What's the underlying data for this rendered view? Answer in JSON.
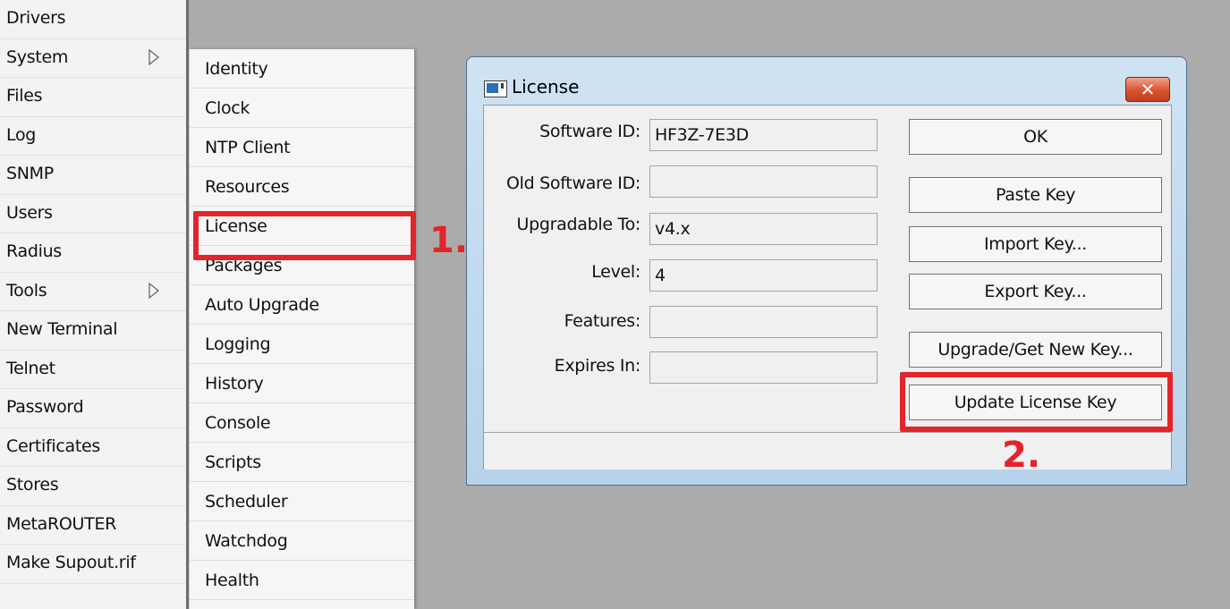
{
  "main_menu": {
    "items": [
      {
        "label": "Drivers",
        "has_submenu": false
      },
      {
        "label": "System",
        "has_submenu": true
      },
      {
        "label": "Files",
        "has_submenu": false
      },
      {
        "label": "Log",
        "has_submenu": false
      },
      {
        "label": "SNMP",
        "has_submenu": false
      },
      {
        "label": "Users",
        "has_submenu": false
      },
      {
        "label": "Radius",
        "has_submenu": false
      },
      {
        "label": "Tools",
        "has_submenu": true
      },
      {
        "label": "New Terminal",
        "has_submenu": false
      },
      {
        "label": "Telnet",
        "has_submenu": false
      },
      {
        "label": "Password",
        "has_submenu": false
      },
      {
        "label": "Certificates",
        "has_submenu": false
      },
      {
        "label": "Stores",
        "has_submenu": false
      },
      {
        "label": "MetaROUTER",
        "has_submenu": false
      },
      {
        "label": "Make Supout.rif",
        "has_submenu": false
      }
    ]
  },
  "system_submenu": {
    "items": [
      {
        "label": "Identity"
      },
      {
        "label": "Clock"
      },
      {
        "label": "NTP Client"
      },
      {
        "label": "Resources"
      },
      {
        "label": "License"
      },
      {
        "label": "Packages"
      },
      {
        "label": "Auto Upgrade"
      },
      {
        "label": "Logging"
      },
      {
        "label": "History"
      },
      {
        "label": "Console"
      },
      {
        "label": "Scripts"
      },
      {
        "label": "Scheduler"
      },
      {
        "label": "Watchdog"
      },
      {
        "label": "Health"
      }
    ]
  },
  "annotations": {
    "step1": "1.",
    "step2": "2.",
    "highlight_color": "#e3242b"
  },
  "license_window": {
    "title": "License",
    "close_icon": "✕",
    "fields": [
      {
        "label": "Software ID:",
        "value": "HF3Z-7E3D"
      },
      {
        "label": "Old Software ID:",
        "value": ""
      },
      {
        "label": "Upgradable To:",
        "value": "v4.x"
      },
      {
        "label": "Level:",
        "value": "4"
      },
      {
        "label": "Features:",
        "value": ""
      },
      {
        "label": "Expires In:",
        "value": ""
      }
    ],
    "buttons": {
      "ok": "OK",
      "paste_key": "Paste Key",
      "import_key": "Import Key...",
      "export_key": "Export Key...",
      "upgrade": "Upgrade/Get New Key...",
      "update_license": "Update License Key"
    },
    "status_text": ""
  }
}
